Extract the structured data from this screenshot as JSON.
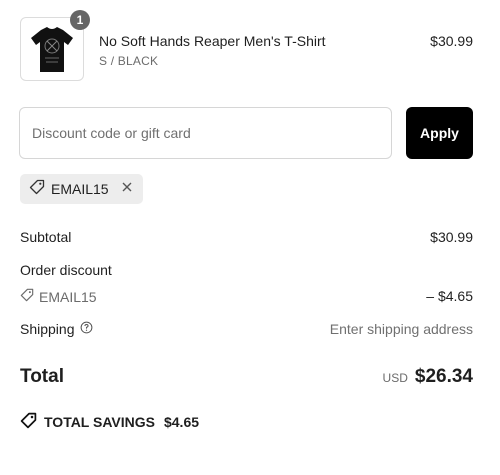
{
  "product": {
    "quantity": "1",
    "title": "No Soft Hands Reaper Men's T-Shirt",
    "variant": "S / BLACK",
    "price": "$30.99",
    "image_icon": "tshirt-icon"
  },
  "discount_form": {
    "placeholder": "Discount code or gift card",
    "value": "",
    "apply_label": "Apply"
  },
  "applied_code": {
    "code": "EMAIL15",
    "icon": "tag-icon",
    "remove_icon": "close-icon"
  },
  "summary": {
    "subtotal_label": "Subtotal",
    "subtotal_value": "$30.99",
    "order_discount_label": "Order discount",
    "discount_code": "EMAIL15",
    "discount_amount": "– $4.65",
    "shipping_label": "Shipping",
    "shipping_value": "Enter shipping address",
    "total_label": "Total",
    "currency": "USD",
    "total_value": "$26.34",
    "savings_label": "TOTAL SAVINGS",
    "savings_value": "$4.65"
  },
  "colors": {
    "button_bg": "#000000",
    "chip_bg": "#ededed",
    "muted_text": "#6b6b6b",
    "badge_bg": "#666666"
  }
}
